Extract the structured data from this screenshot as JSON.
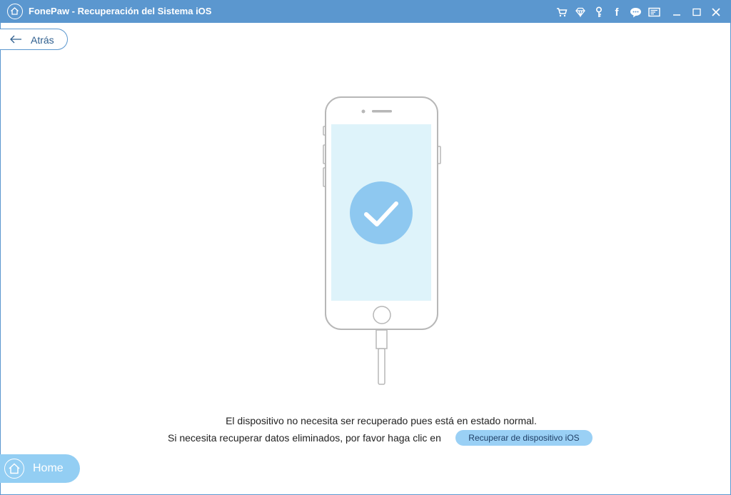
{
  "window": {
    "title": "FonePaw - Recuperación del Sistema iOS",
    "titlebar_icons": [
      "cart-icon",
      "diamond-icon",
      "key-icon",
      "facebook-icon",
      "chat-icon",
      "feedback-icon",
      "minimize-icon",
      "maximize-icon",
      "close-icon"
    ]
  },
  "toolbar": {
    "back_label": "Atrás"
  },
  "main": {
    "message_line1": "El dispositivo no necesita ser recuperado pues está en estado normal.",
    "message_line2": "Si necesita recuperar datos eliminados, por favor haga clic en",
    "recover_button_label": "Recuperar de dispositivo iOS"
  },
  "footer": {
    "home_label": "Home"
  },
  "colors": {
    "titlebar": "#5b97cf",
    "accent": "#93cef3",
    "check_circle": "#8ec8f0",
    "screen": "#def3fa"
  }
}
